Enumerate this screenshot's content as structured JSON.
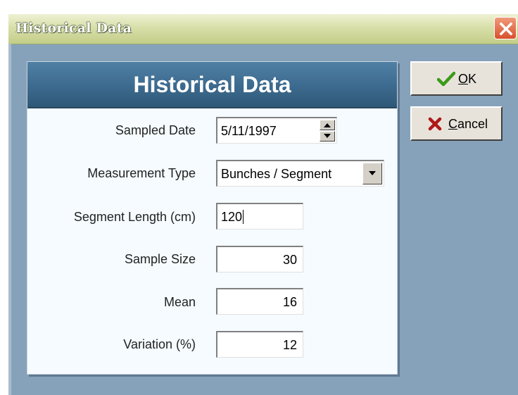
{
  "window": {
    "title": "Historical Data"
  },
  "panel": {
    "heading": "Historical Data"
  },
  "form": {
    "sampled_date": {
      "label": "Sampled Date",
      "value": "5/11/1997"
    },
    "measurement_type": {
      "label": "Measurement Type",
      "value": "Bunches / Segment"
    },
    "segment_length": {
      "label": "Segment Length (cm)",
      "value": "120"
    },
    "sample_size": {
      "label": "Sample Size",
      "value": "30"
    },
    "mean": {
      "label": "Mean",
      "value": "16"
    },
    "variation": {
      "label": "Variation (%)",
      "value": "12"
    }
  },
  "buttons": {
    "ok": {
      "label_first": "O",
      "label_rest": "K",
      "icon": "checkmark-icon"
    },
    "cancel": {
      "label_first": "C",
      "label_rest": "ancel",
      "icon": "x-icon"
    }
  },
  "colors": {
    "window_bg": "#86a2bb",
    "title_bar": "#d8dfa9",
    "panel_header": "#3c6a8e",
    "close_button": "#d8502c",
    "check_green": "#3a9a1a",
    "cancel_x": "#b01818"
  }
}
